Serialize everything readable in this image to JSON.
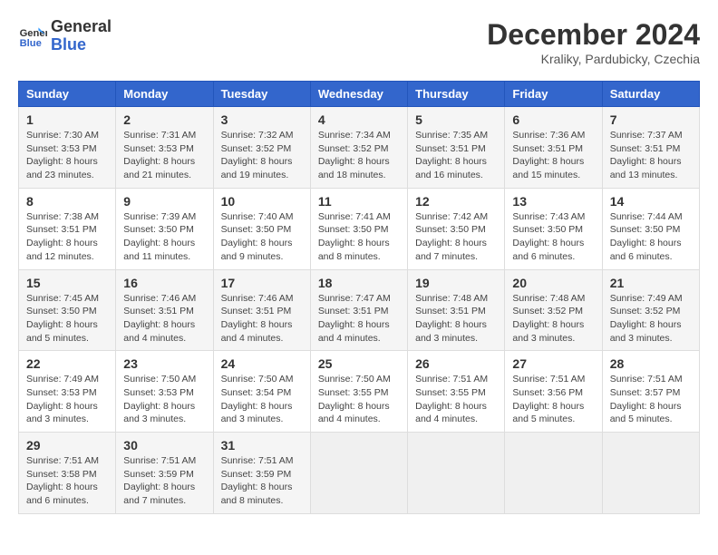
{
  "header": {
    "logo_line1": "General",
    "logo_line2": "Blue",
    "month_title": "December 2024",
    "location": "Kraliky, Pardubicky, Czechia"
  },
  "weekdays": [
    "Sunday",
    "Monday",
    "Tuesday",
    "Wednesday",
    "Thursday",
    "Friday",
    "Saturday"
  ],
  "weeks": [
    [
      {
        "day": "1",
        "sunrise": "7:30 AM",
        "sunset": "3:53 PM",
        "daylight": "8 hours and 23 minutes."
      },
      {
        "day": "2",
        "sunrise": "7:31 AM",
        "sunset": "3:53 PM",
        "daylight": "8 hours and 21 minutes."
      },
      {
        "day": "3",
        "sunrise": "7:32 AM",
        "sunset": "3:52 PM",
        "daylight": "8 hours and 19 minutes."
      },
      {
        "day": "4",
        "sunrise": "7:34 AM",
        "sunset": "3:52 PM",
        "daylight": "8 hours and 18 minutes."
      },
      {
        "day": "5",
        "sunrise": "7:35 AM",
        "sunset": "3:51 PM",
        "daylight": "8 hours and 16 minutes."
      },
      {
        "day": "6",
        "sunrise": "7:36 AM",
        "sunset": "3:51 PM",
        "daylight": "8 hours and 15 minutes."
      },
      {
        "day": "7",
        "sunrise": "7:37 AM",
        "sunset": "3:51 PM",
        "daylight": "8 hours and 13 minutes."
      }
    ],
    [
      {
        "day": "8",
        "sunrise": "7:38 AM",
        "sunset": "3:51 PM",
        "daylight": "8 hours and 12 minutes."
      },
      {
        "day": "9",
        "sunrise": "7:39 AM",
        "sunset": "3:50 PM",
        "daylight": "8 hours and 11 minutes."
      },
      {
        "day": "10",
        "sunrise": "7:40 AM",
        "sunset": "3:50 PM",
        "daylight": "8 hours and 9 minutes."
      },
      {
        "day": "11",
        "sunrise": "7:41 AM",
        "sunset": "3:50 PM",
        "daylight": "8 hours and 8 minutes."
      },
      {
        "day": "12",
        "sunrise": "7:42 AM",
        "sunset": "3:50 PM",
        "daylight": "8 hours and 7 minutes."
      },
      {
        "day": "13",
        "sunrise": "7:43 AM",
        "sunset": "3:50 PM",
        "daylight": "8 hours and 6 minutes."
      },
      {
        "day": "14",
        "sunrise": "7:44 AM",
        "sunset": "3:50 PM",
        "daylight": "8 hours and 6 minutes."
      }
    ],
    [
      {
        "day": "15",
        "sunrise": "7:45 AM",
        "sunset": "3:50 PM",
        "daylight": "8 hours and 5 minutes."
      },
      {
        "day": "16",
        "sunrise": "7:46 AM",
        "sunset": "3:51 PM",
        "daylight": "8 hours and 4 minutes."
      },
      {
        "day": "17",
        "sunrise": "7:46 AM",
        "sunset": "3:51 PM",
        "daylight": "8 hours and 4 minutes."
      },
      {
        "day": "18",
        "sunrise": "7:47 AM",
        "sunset": "3:51 PM",
        "daylight": "8 hours and 4 minutes."
      },
      {
        "day": "19",
        "sunrise": "7:48 AM",
        "sunset": "3:51 PM",
        "daylight": "8 hours and 3 minutes."
      },
      {
        "day": "20",
        "sunrise": "7:48 AM",
        "sunset": "3:52 PM",
        "daylight": "8 hours and 3 minutes."
      },
      {
        "day": "21",
        "sunrise": "7:49 AM",
        "sunset": "3:52 PM",
        "daylight": "8 hours and 3 minutes."
      }
    ],
    [
      {
        "day": "22",
        "sunrise": "7:49 AM",
        "sunset": "3:53 PM",
        "daylight": "8 hours and 3 minutes."
      },
      {
        "day": "23",
        "sunrise": "7:50 AM",
        "sunset": "3:53 PM",
        "daylight": "8 hours and 3 minutes."
      },
      {
        "day": "24",
        "sunrise": "7:50 AM",
        "sunset": "3:54 PM",
        "daylight": "8 hours and 3 minutes."
      },
      {
        "day": "25",
        "sunrise": "7:50 AM",
        "sunset": "3:55 PM",
        "daylight": "8 hours and 4 minutes."
      },
      {
        "day": "26",
        "sunrise": "7:51 AM",
        "sunset": "3:55 PM",
        "daylight": "8 hours and 4 minutes."
      },
      {
        "day": "27",
        "sunrise": "7:51 AM",
        "sunset": "3:56 PM",
        "daylight": "8 hours and 5 minutes."
      },
      {
        "day": "28",
        "sunrise": "7:51 AM",
        "sunset": "3:57 PM",
        "daylight": "8 hours and 5 minutes."
      }
    ],
    [
      {
        "day": "29",
        "sunrise": "7:51 AM",
        "sunset": "3:58 PM",
        "daylight": "8 hours and 6 minutes."
      },
      {
        "day": "30",
        "sunrise": "7:51 AM",
        "sunset": "3:59 PM",
        "daylight": "8 hours and 7 minutes."
      },
      {
        "day": "31",
        "sunrise": "7:51 AM",
        "sunset": "3:59 PM",
        "daylight": "8 hours and 8 minutes."
      },
      null,
      null,
      null,
      null
    ]
  ]
}
